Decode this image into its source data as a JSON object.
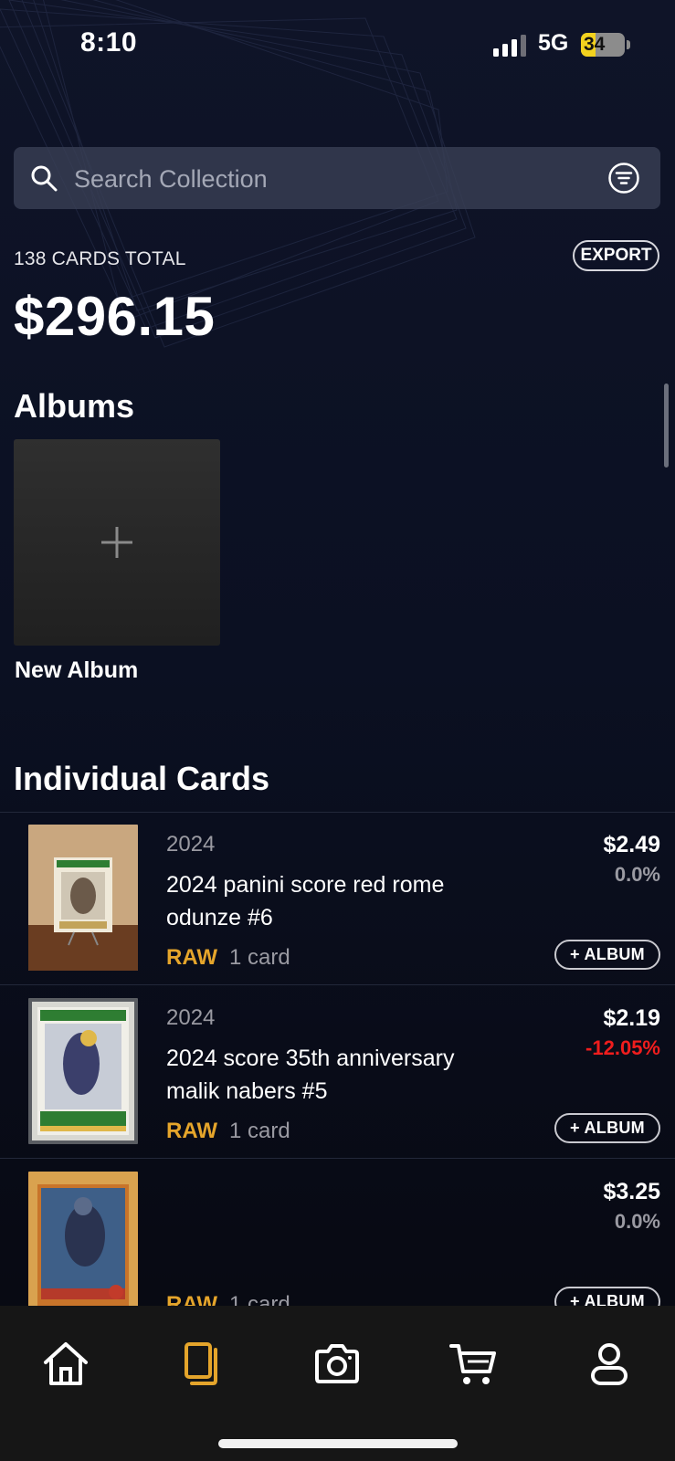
{
  "status_bar": {
    "time": "8:10",
    "network": "5G",
    "battery": "34",
    "battery_level": 0.34
  },
  "search": {
    "placeholder": "Search Collection"
  },
  "summary": {
    "count_label": "138 CARDS TOTAL",
    "export_label": "EXPORT",
    "total_value": "$296.15"
  },
  "albums": {
    "title": "Albums",
    "new_album_label": "New Album"
  },
  "cards": {
    "title": "Individual Cards",
    "add_album_label": "+ ALBUM",
    "items": [
      {
        "year": "2024",
        "title": "2024 panini score red rome odunze #6",
        "condition": "RAW",
        "quantity": "1 card",
        "price": "$2.49",
        "change": "0.0%"
      },
      {
        "year": "2024",
        "title": "2024 score 35th anniversary malik nabers #5",
        "condition": "RAW",
        "quantity": "1 card",
        "price": "$2.19",
        "change": "-12.05%"
      },
      {
        "year": "",
        "title": "",
        "condition": "RAW",
        "quantity": "1 card",
        "price": "$3.25",
        "change": "0.0%"
      }
    ]
  },
  "tabs": [
    "home-icon",
    "collection-icon",
    "camera-icon",
    "cart-icon",
    "profile-icon"
  ],
  "colors": {
    "accent": "#e5a52b",
    "negative": "#f01d1d",
    "background": "#0b0f1e",
    "tabbar": "#161616"
  }
}
